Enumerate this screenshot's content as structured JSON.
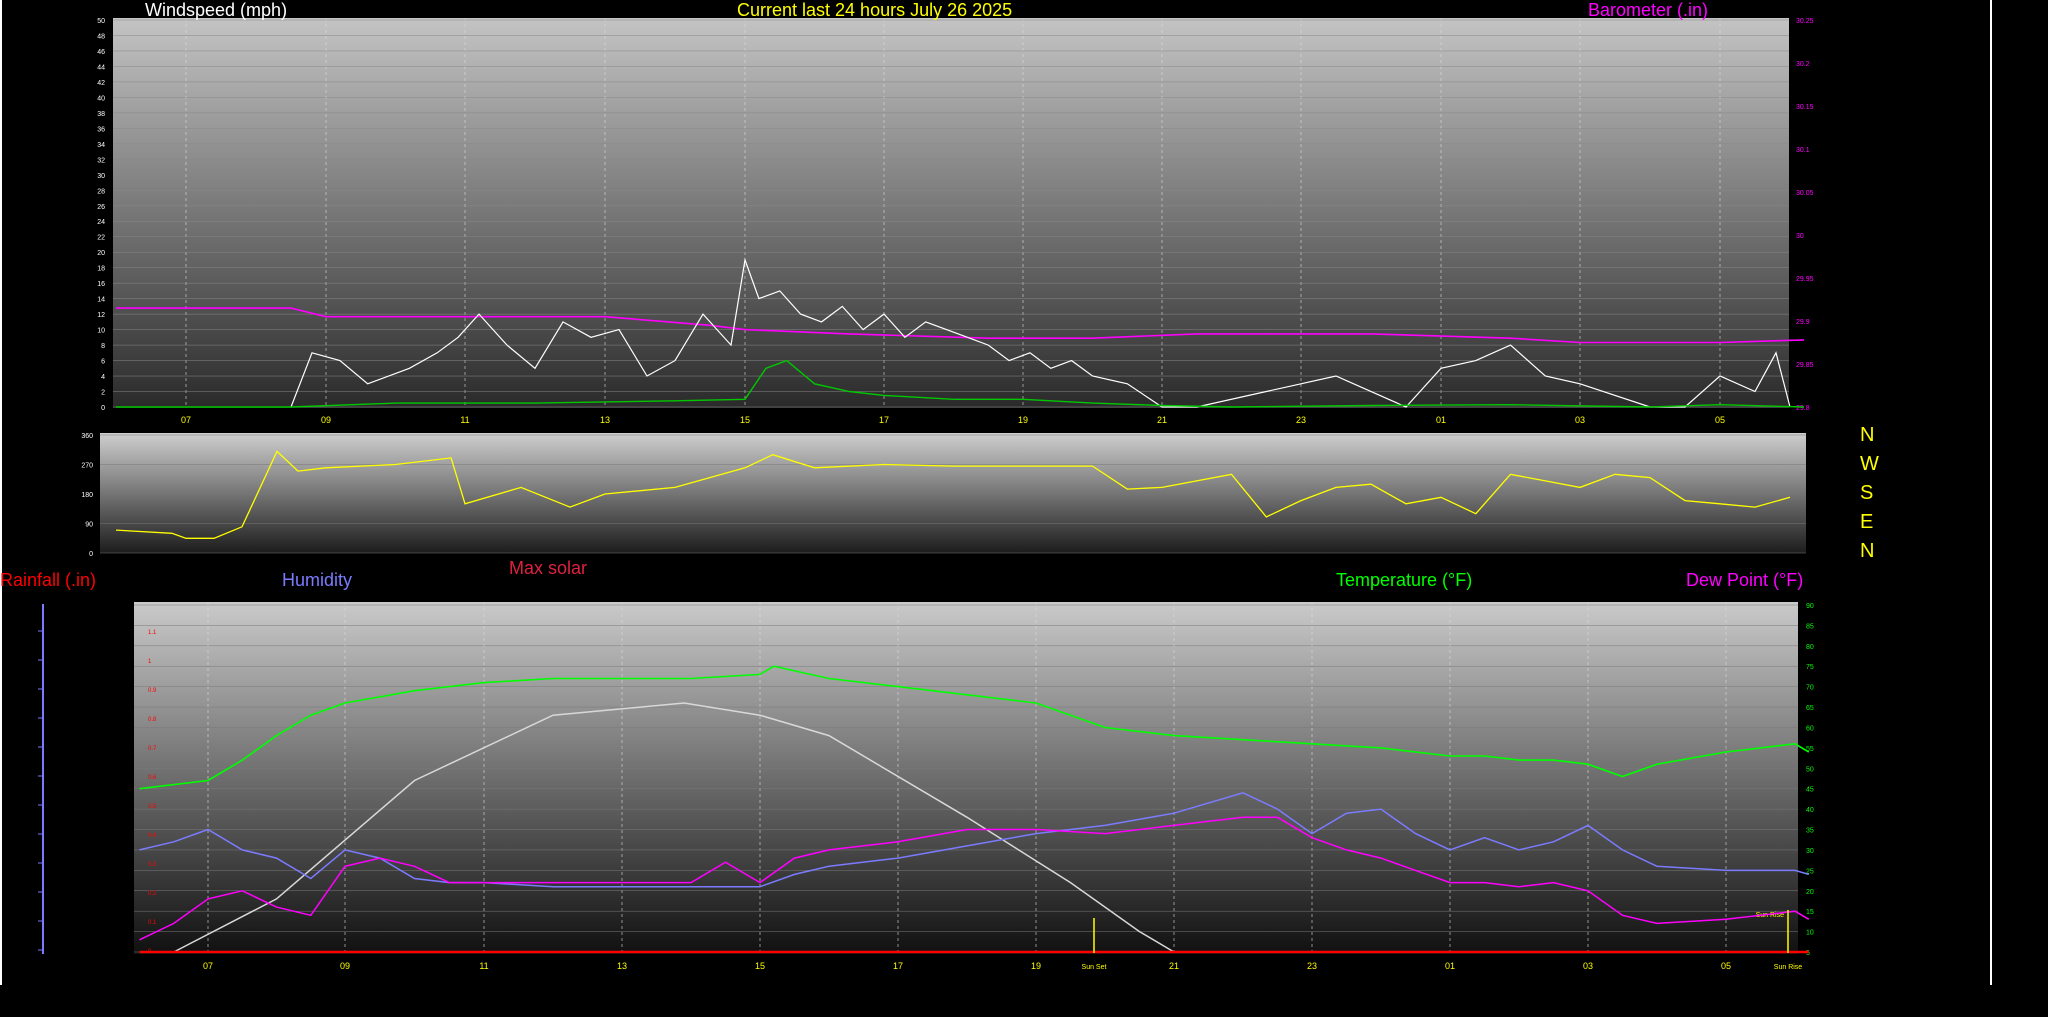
{
  "headers": {
    "windspeed": "Windspeed (mph)",
    "title": "Current last 24 hours July 26 2025",
    "barometer": "Barometer (.in)",
    "rainfall": "Rainfall (.in)",
    "humidity": "Humidity",
    "max_solar": "Max solar",
    "temperature": "Temperature (°F)",
    "dew_point": "Dew Point (°F)"
  },
  "compass": [
    "N",
    "W",
    "S",
    "E",
    "N"
  ],
  "colors": {
    "background": "#000000",
    "wind": "#ffffff",
    "wind_avg": "#00c800",
    "barometer": "#ff00ff",
    "direction": "#ffff00",
    "rainfall": "#ff0000",
    "humidity": "#7b7bff",
    "max_solar": "#e02040",
    "solar_curve": "#d8d8d8",
    "temperature": "#00ff00",
    "dew_point": "#ff00ff",
    "title": "#ffff00",
    "axis_hours": "#ffff00"
  },
  "chart_data": [
    {
      "type": "line",
      "name": "wind_barometer",
      "title": "Current last 24 hours July 26 2025",
      "x_ticks": [
        "07",
        "09",
        "11",
        "13",
        "15",
        "17",
        "19",
        "21",
        "23",
        "01",
        "03",
        "05"
      ],
      "x_range_hours": [
        6.0,
        30.2
      ],
      "y_left": {
        "label": "Windspeed (mph)",
        "ylim": [
          0,
          50
        ],
        "ticks": [
          0,
          2,
          4,
          6,
          8,
          10,
          12,
          14,
          16,
          18,
          20,
          22,
          24,
          26,
          28,
          30,
          32,
          34,
          36,
          38,
          40,
          42,
          44,
          46,
          48,
          50
        ]
      },
      "y_right": {
        "label": "Barometer (.in)",
        "ylim": [
          29.8,
          30.25
        ],
        "ticks": [
          "29.8",
          "29.85",
          "29.9",
          "29.95",
          "30",
          "30.05",
          "30.1",
          "30.15",
          "30.2",
          "30.25"
        ]
      },
      "series": [
        {
          "name": "Barometer (.in)",
          "axis": "right",
          "x": [
            6.0,
            8.5,
            9.0,
            11.5,
            13.0,
            14.5,
            15.0,
            16.5,
            18.5,
            20.0,
            21.5,
            24.0,
            26.0,
            27.0,
            29.0,
            30.2
          ],
          "y": [
            29.915,
            29.915,
            29.905,
            29.905,
            29.905,
            29.895,
            29.89,
            29.885,
            29.88,
            29.88,
            29.885,
            29.885,
            29.88,
            29.875,
            29.875,
            29.878
          ]
        },
        {
          "name": "Wind gust",
          "axis": "left",
          "x": [
            8.5,
            8.8,
            9.2,
            9.6,
            10.2,
            10.6,
            10.9,
            11.2,
            11.6,
            12.0,
            12.4,
            12.8,
            13.2,
            13.6,
            14.0,
            14.4,
            14.8,
            15.0,
            15.2,
            15.5,
            15.8,
            16.1,
            16.4,
            16.7,
            17.0,
            17.3,
            17.6,
            17.9,
            18.2,
            18.5,
            18.8,
            19.1,
            19.4,
            19.7,
            20.0,
            20.5,
            21.0,
            21.5,
            22.5,
            23.0,
            23.5,
            24.5,
            25.0,
            25.5,
            26.0,
            26.5,
            27.0,
            28.0,
            28.5,
            29.0,
            29.5,
            29.8,
            30.0
          ],
          "y": [
            0,
            7,
            6,
            3,
            5,
            7,
            9,
            12,
            8,
            5,
            11,
            9,
            10,
            4,
            6,
            12,
            8,
            19,
            14,
            15,
            12,
            11,
            13,
            10,
            12,
            9,
            11,
            10,
            9,
            8,
            6,
            7,
            5,
            6,
            4,
            3,
            0,
            0,
            2,
            3,
            4,
            0,
            5,
            6,
            8,
            4,
            3,
            0,
            0,
            4,
            2,
            7,
            0
          ]
        },
        {
          "name": "Wind average",
          "axis": "left",
          "x": [
            6.0,
            8.5,
            10.0,
            12.0,
            14.0,
            15.0,
            15.3,
            15.6,
            16.0,
            16.5,
            17.0,
            18.0,
            19.0,
            20.0,
            21.0,
            22.0,
            24.0,
            26.0,
            28.0,
            29.0,
            30.2
          ],
          "y": [
            0,
            0,
            0.5,
            0.5,
            0.8,
            1,
            5,
            6,
            3,
            2,
            1.5,
            1,
            1,
            0.5,
            0.2,
            0,
            0.2,
            0.3,
            0,
            0.3,
            0
          ]
        }
      ]
    },
    {
      "type": "line",
      "name": "wind_direction",
      "y_ticks": [
        0,
        90,
        180,
        270,
        360
      ],
      "ylim": [
        0,
        360
      ],
      "right_labels": [
        "N",
        "W",
        "S",
        "E",
        "N"
      ],
      "series": [
        {
          "name": "Wind direction",
          "x": [
            6.0,
            6.8,
            7.0,
            7.4,
            7.8,
            8.3,
            8.6,
            9.0,
            10.0,
            10.8,
            11.0,
            11.8,
            12.5,
            13.0,
            14.0,
            15.0,
            15.4,
            16.0,
            17.0,
            18.0,
            19.0,
            20.0,
            20.5,
            21.0,
            22.0,
            22.5,
            23.0,
            23.5,
            24.0,
            24.5,
            25.0,
            25.5,
            26.0,
            26.5,
            27.0,
            27.5,
            28.0,
            28.5,
            29.0,
            29.5,
            30.0
          ],
          "y": [
            70,
            60,
            45,
            45,
            80,
            310,
            250,
            260,
            270,
            290,
            150,
            200,
            140,
            180,
            200,
            260,
            300,
            260,
            270,
            265,
            265,
            265,
            195,
            200,
            240,
            110,
            160,
            200,
            210,
            150,
            170,
            120,
            240,
            220,
            200,
            240,
            230,
            160,
            150,
            140,
            170
          ]
        }
      ]
    },
    {
      "type": "line",
      "name": "temp_humidity_rain",
      "x_ticks": [
        "07",
        "09",
        "11",
        "13",
        "15",
        "17",
        "19",
        "21",
        "23",
        "01",
        "03",
        "05"
      ],
      "annotations": [
        "Sun Set",
        "Sun Rise"
      ],
      "y_left": {
        "label": "Rainfall (.in)",
        "ticks": [
          "0",
          "0.1",
          "0.2",
          "0.3",
          "0.4",
          "0.5",
          "0.6",
          "0.7",
          "0.8",
          "0.9",
          "1",
          "1.1"
        ]
      },
      "y_right": {
        "label": "Temperature (°F)",
        "ylim": [
          5,
          90
        ],
        "ticks": [
          5,
          10,
          15,
          20,
          25,
          30,
          35,
          40,
          45,
          50,
          55,
          60,
          65,
          70,
          75,
          80,
          85,
          90
        ]
      },
      "series": [
        {
          "name": "Temperature (°F)",
          "x": [
            6.0,
            7.0,
            7.5,
            8.0,
            8.5,
            9.0,
            10.0,
            11.0,
            12.0,
            13.0,
            14.0,
            15.0,
            15.2,
            16.0,
            17.0,
            18.0,
            19.0,
            19.5,
            20.0,
            21.0,
            22.0,
            23.0,
            24.0,
            25.0,
            25.5,
            26.0,
            26.5,
            27.0,
            27.5,
            28.0,
            29.0,
            29.5,
            30.0,
            30.2
          ],
          "y": [
            45,
            47,
            52,
            58,
            63,
            66,
            69,
            71,
            72,
            72,
            72,
            73,
            75,
            72,
            70,
            68,
            66,
            63,
            60,
            58,
            57,
            56,
            55,
            53,
            53,
            52,
            52,
            51,
            48,
            51,
            54,
            55,
            56,
            54
          ]
        },
        {
          "name": "Humidity",
          "x": [
            6.0,
            6.5,
            7.0,
            7.5,
            8.0,
            8.5,
            9.0,
            9.5,
            10.0,
            10.5,
            11.0,
            12.0,
            13.0,
            14.0,
            15.0,
            15.5,
            16.0,
            17.0,
            18.0,
            19.0,
            20.0,
            21.0,
            22.0,
            22.5,
            23.0,
            23.5,
            24.0,
            24.5,
            25.0,
            25.5,
            26.0,
            26.5,
            27.0,
            27.5,
            28.0,
            29.0,
            30.0,
            30.2
          ],
          "y": [
            30,
            32,
            35,
            30,
            28,
            23,
            30,
            28,
            23,
            22,
            22,
            21,
            21,
            21,
            21,
            24,
            26,
            28,
            31,
            34,
            36,
            39,
            44,
            40,
            34,
            39,
            40,
            34,
            30,
            33,
            30,
            32,
            36,
            30,
            26,
            25,
            25,
            24
          ]
        },
        {
          "name": "Dew Point (°F)",
          "x": [
            6.0,
            6.5,
            7.0,
            7.5,
            8.0,
            8.5,
            9.0,
            9.5,
            10.0,
            10.5,
            11.0,
            12.0,
            13.0,
            14.0,
            14.5,
            15.0,
            15.5,
            16.0,
            17.0,
            18.0,
            19.0,
            20.0,
            21.0,
            22.0,
            22.5,
            23.0,
            23.5,
            24.0,
            24.5,
            25.0,
            25.5,
            26.0,
            26.5,
            27.0,
            27.5,
            28.0,
            29.0,
            30.0,
            30.2
          ],
          "y": [
            8,
            12,
            18,
            20,
            16,
            14,
            26,
            28,
            26,
            22,
            22,
            22,
            22,
            22,
            27,
            22,
            28,
            30,
            32,
            35,
            35,
            34,
            36,
            38,
            38,
            33,
            30,
            28,
            25,
            22,
            22,
            21,
            22,
            20,
            14,
            12,
            13,
            15,
            13
          ]
        },
        {
          "name": "Max solar",
          "x": [
            6.5,
            8.0,
            10.0,
            12.0,
            13.9,
            15.0,
            16.0,
            18.0,
            19.5,
            20.5,
            21.0
          ],
          "y": [
            5,
            18,
            47,
            63,
            66,
            63,
            58,
            38,
            22,
            10,
            5
          ]
        },
        {
          "name": "Rainfall (.in)",
          "x": [
            6.0,
            30.2
          ],
          "y": [
            0,
            0
          ]
        }
      ]
    }
  ]
}
